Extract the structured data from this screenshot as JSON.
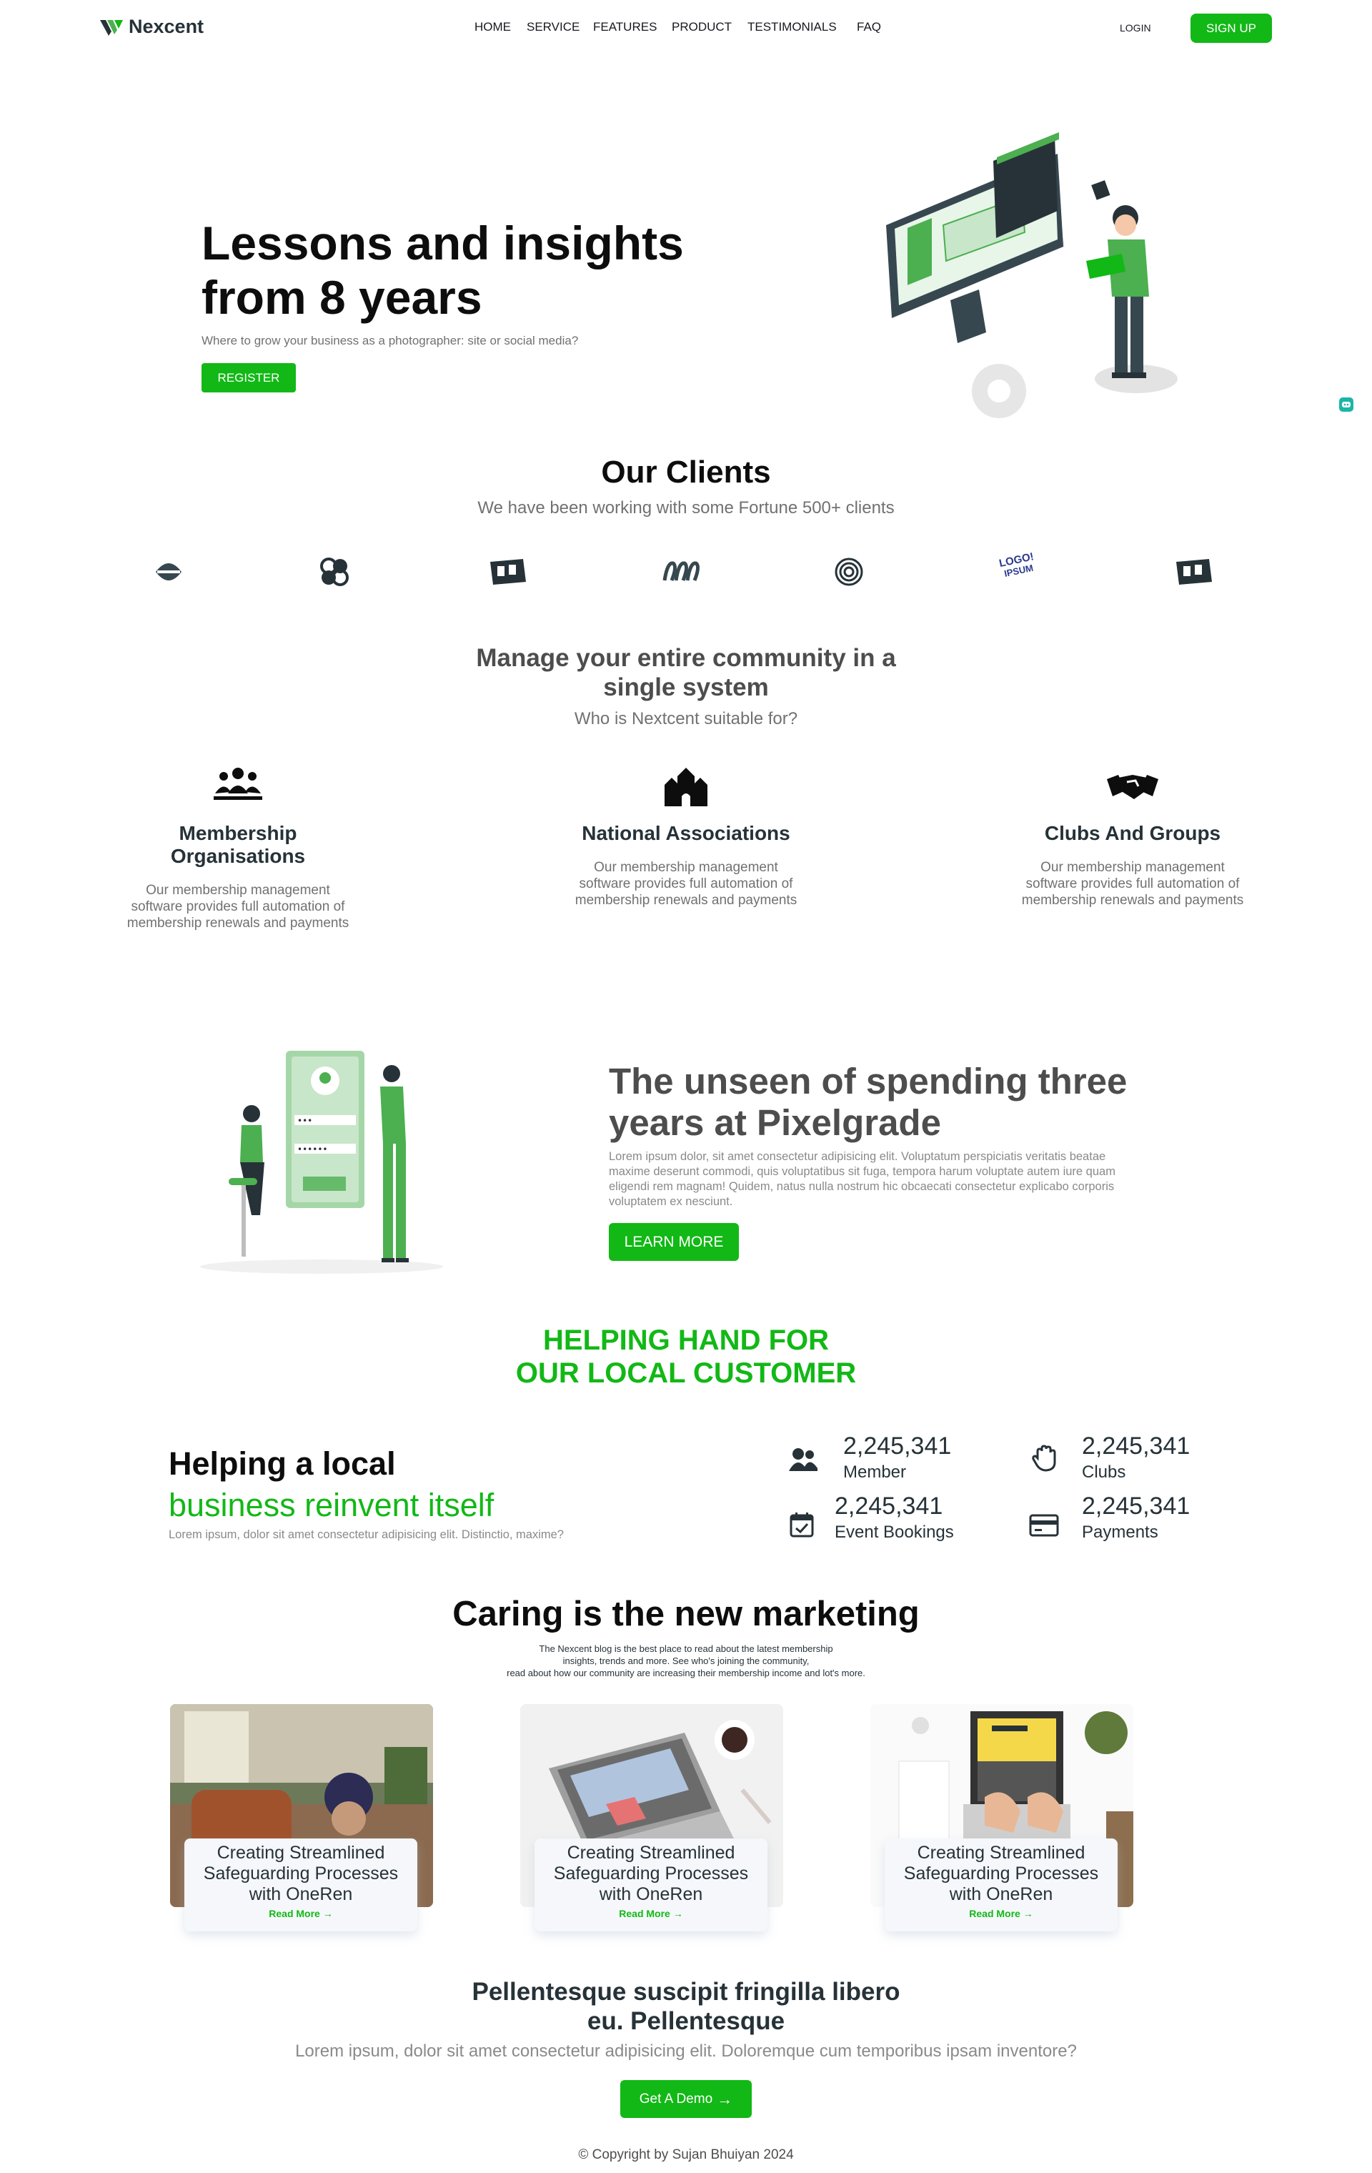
{
  "header": {
    "brand": "Nexcent",
    "nav": [
      "HOME",
      "SERVICE",
      "FEATURES",
      "PRODUCT",
      "TESTIMONIALS",
      "FAQ"
    ],
    "login": "LOGIN",
    "signup": "SIGN UP"
  },
  "hero": {
    "title_line1": "Lessons and insights",
    "title_line2": "from 8 years",
    "subtitle": "Where to grow your business as a photographer: site or social media?",
    "cta": "REGISTER"
  },
  "clients": {
    "title": "Our Clients",
    "subtitle": "We have been working with some Fortune 500+ clients",
    "logo_icons": [
      "client-logo-1-icon",
      "client-logo-2-icon",
      "client-logo-3-icon",
      "client-logo-4-icon",
      "client-logo-5-icon",
      "client-logo-6-icon",
      "client-logo-7-icon"
    ],
    "logo_6_text": [
      "LOGO!",
      "IPSUM"
    ]
  },
  "community": {
    "title_line1": "Manage your entire community in a",
    "title_line2": "single system",
    "subtitle": "Who is Nextcent suitable for?",
    "cards": [
      {
        "icon": "people-group-icon",
        "title_line1": "Membership",
        "title_line2": "Organisations",
        "text_line1": "Our membership management",
        "text_line2": "software provides full automation of",
        "text_line3": "membership renewals and payments"
      },
      {
        "icon": "building-icon",
        "title_line1": "National Associations",
        "title_line2": "",
        "text_line1": "Our membership management",
        "text_line2": "software provides full automation of",
        "text_line3": "membership renewals and payments"
      },
      {
        "icon": "handshake-icon",
        "title_line1": "Clubs And Groups",
        "title_line2": "",
        "text_line1": "Our membership management",
        "text_line2": "software provides full automation of",
        "text_line3": "membership renewals and payments"
      }
    ]
  },
  "unseen": {
    "title_line1": "The unseen of spending three",
    "title_line2": "years at Pixelgrade",
    "text_line1": "Lorem ipsum dolor, sit amet consectetur adipisicing elit. Voluptatum perspiciatis veritatis beatae",
    "text_line2": "maxime deserunt commodi, quis voluptatibus sit fuga, tempora harum voluptate autem iure quam",
    "text_line3": "eligendi rem magnam! Quidem, natus nulla nostrum hic obcaecati consectetur explicabo corporis",
    "text_line4": "voluptatem ex nesciunt.",
    "cta": "LEARN MORE"
  },
  "helping": {
    "title_line1": "HELPING HAND FOR",
    "title_line2": "OUR LOCAL CUSTOMER"
  },
  "stats": {
    "title_line1": "Helping a local",
    "title_line2": "business reinvent itself",
    "subtitle": "Lorem ipsum, dolor sit amet consectetur adipisicing elit. Distinctio, maxime?",
    "items": [
      {
        "icon": "members-icon",
        "value": "2,245,341",
        "label": "Member"
      },
      {
        "icon": "hand-icon",
        "value": "2,245,341",
        "label": "Clubs"
      },
      {
        "icon": "calendar-check-icon",
        "value": "2,245,341",
        "label": "Event Bookings"
      },
      {
        "icon": "payment-card-icon",
        "value": "2,245,341",
        "label": "Payments"
      }
    ]
  },
  "blog": {
    "title": "Caring is the new marketing",
    "text_line1": "The Nexcent blog is the best place to read about the latest membership",
    "text_line2": "insights, trends and more. See who's joining the community,",
    "text_line3": "read about how our community are increasing their membership income and lot's more.",
    "cards": [
      {
        "line1": "Creating Streamlined",
        "line2": "Safeguarding Processes",
        "line3": "with OneRen",
        "read_more": "Read More"
      },
      {
        "line1": "Creating Streamlined",
        "line2": "Safeguarding Processes",
        "line3": "with OneRen",
        "read_more": "Read More"
      },
      {
        "line1": "Creating Streamlined",
        "line2": "Safeguarding Processes",
        "line3": "with OneRen",
        "read_more": "Read More"
      }
    ]
  },
  "cta": {
    "title_line1": "Pellentesque suscipit fringilla libero",
    "title_line2": "eu. Pellentesque",
    "subtitle": "Lorem ipsum, dolor sit amet consectetur adipisicing elit. Doloremque cum temporibus ipsam inventore?",
    "button": "Get A Demo"
  },
  "footer": {
    "copyright": "Copyright by Sujan Bhuiyan 2024"
  },
  "colors": {
    "primary": "#12b816",
    "dark": "#263238",
    "grey": "#717171",
    "chat_widget": "#1ab5a8"
  }
}
